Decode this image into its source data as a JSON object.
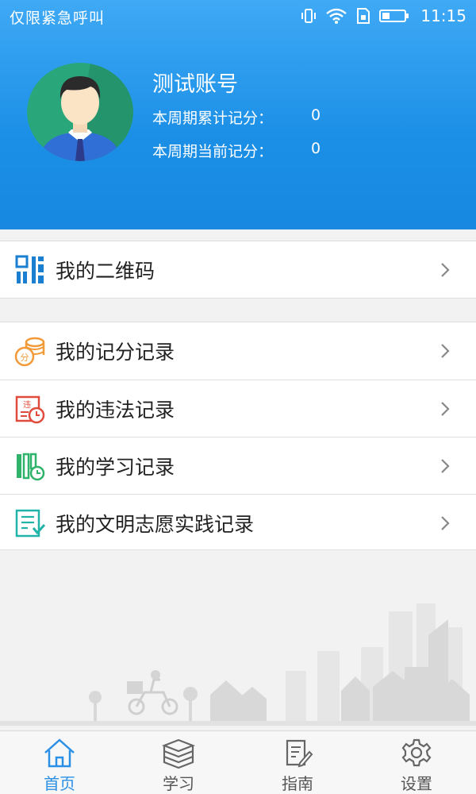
{
  "status_bar": {
    "left_text": "仅限紧急呼叫",
    "time": "11:15",
    "icons": [
      "vibrate-icon",
      "wifi-icon",
      "sim-icon",
      "battery-icon"
    ]
  },
  "profile": {
    "name": "测试账号",
    "stats": [
      {
        "label": "本周期累计记分：",
        "value": "0"
      },
      {
        "label": "本周期当前记分：",
        "value": "0"
      }
    ]
  },
  "menu_group_1": [
    {
      "label": "我的二维码",
      "icon": "qrcode-icon",
      "color": "#1a7fd0"
    }
  ],
  "menu_group_2": [
    {
      "label": "我的记分记录",
      "icon": "coins-icon",
      "color": "#f29a38"
    },
    {
      "label": "我的违法记录",
      "icon": "violation-clock-icon",
      "color": "#e04b3b"
    },
    {
      "label": "我的学习记录",
      "icon": "book-clock-icon",
      "color": "#2fb36a"
    },
    {
      "label": "我的文明志愿实践记录",
      "icon": "checklist-icon",
      "color": "#21b3a7"
    }
  ],
  "tabbar": {
    "tabs": [
      {
        "label": "首页",
        "icon": "home-icon",
        "active": true
      },
      {
        "label": "学习",
        "icon": "books-icon",
        "active": false
      },
      {
        "label": "指南",
        "icon": "guide-icon",
        "active": false
      },
      {
        "label": "设置",
        "icon": "gear-icon",
        "active": false
      }
    ]
  },
  "colors": {
    "header": "#1b8fe6",
    "active_tab": "#2a90e6"
  }
}
